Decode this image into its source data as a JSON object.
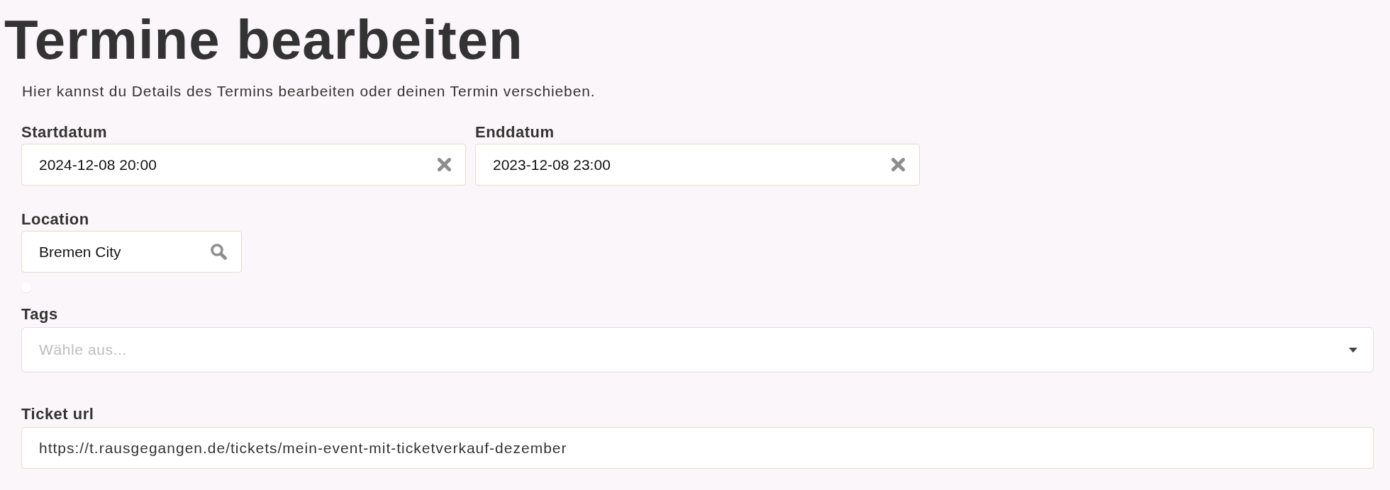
{
  "heading": {
    "title": "Termine bearbeiten",
    "description": "Hier kannst du Details des Termins bearbeiten oder deinen Termin verschieben."
  },
  "dates": [
    {
      "label": "Startdatum",
      "value": "2024-12-08 20:00"
    },
    {
      "label": "Enddatum",
      "value": "2023-12-08 23:00"
    }
  ],
  "location": {
    "label": "Location",
    "value": "Bremen City"
  },
  "tags": {
    "label": "Tags",
    "placeholder": "Wähle aus..."
  },
  "ticket_url": {
    "label": "Ticket url",
    "value": "https://t.rausgegangen.de/tickets/mein-event-mit-ticketverkauf-dezember"
  }
}
